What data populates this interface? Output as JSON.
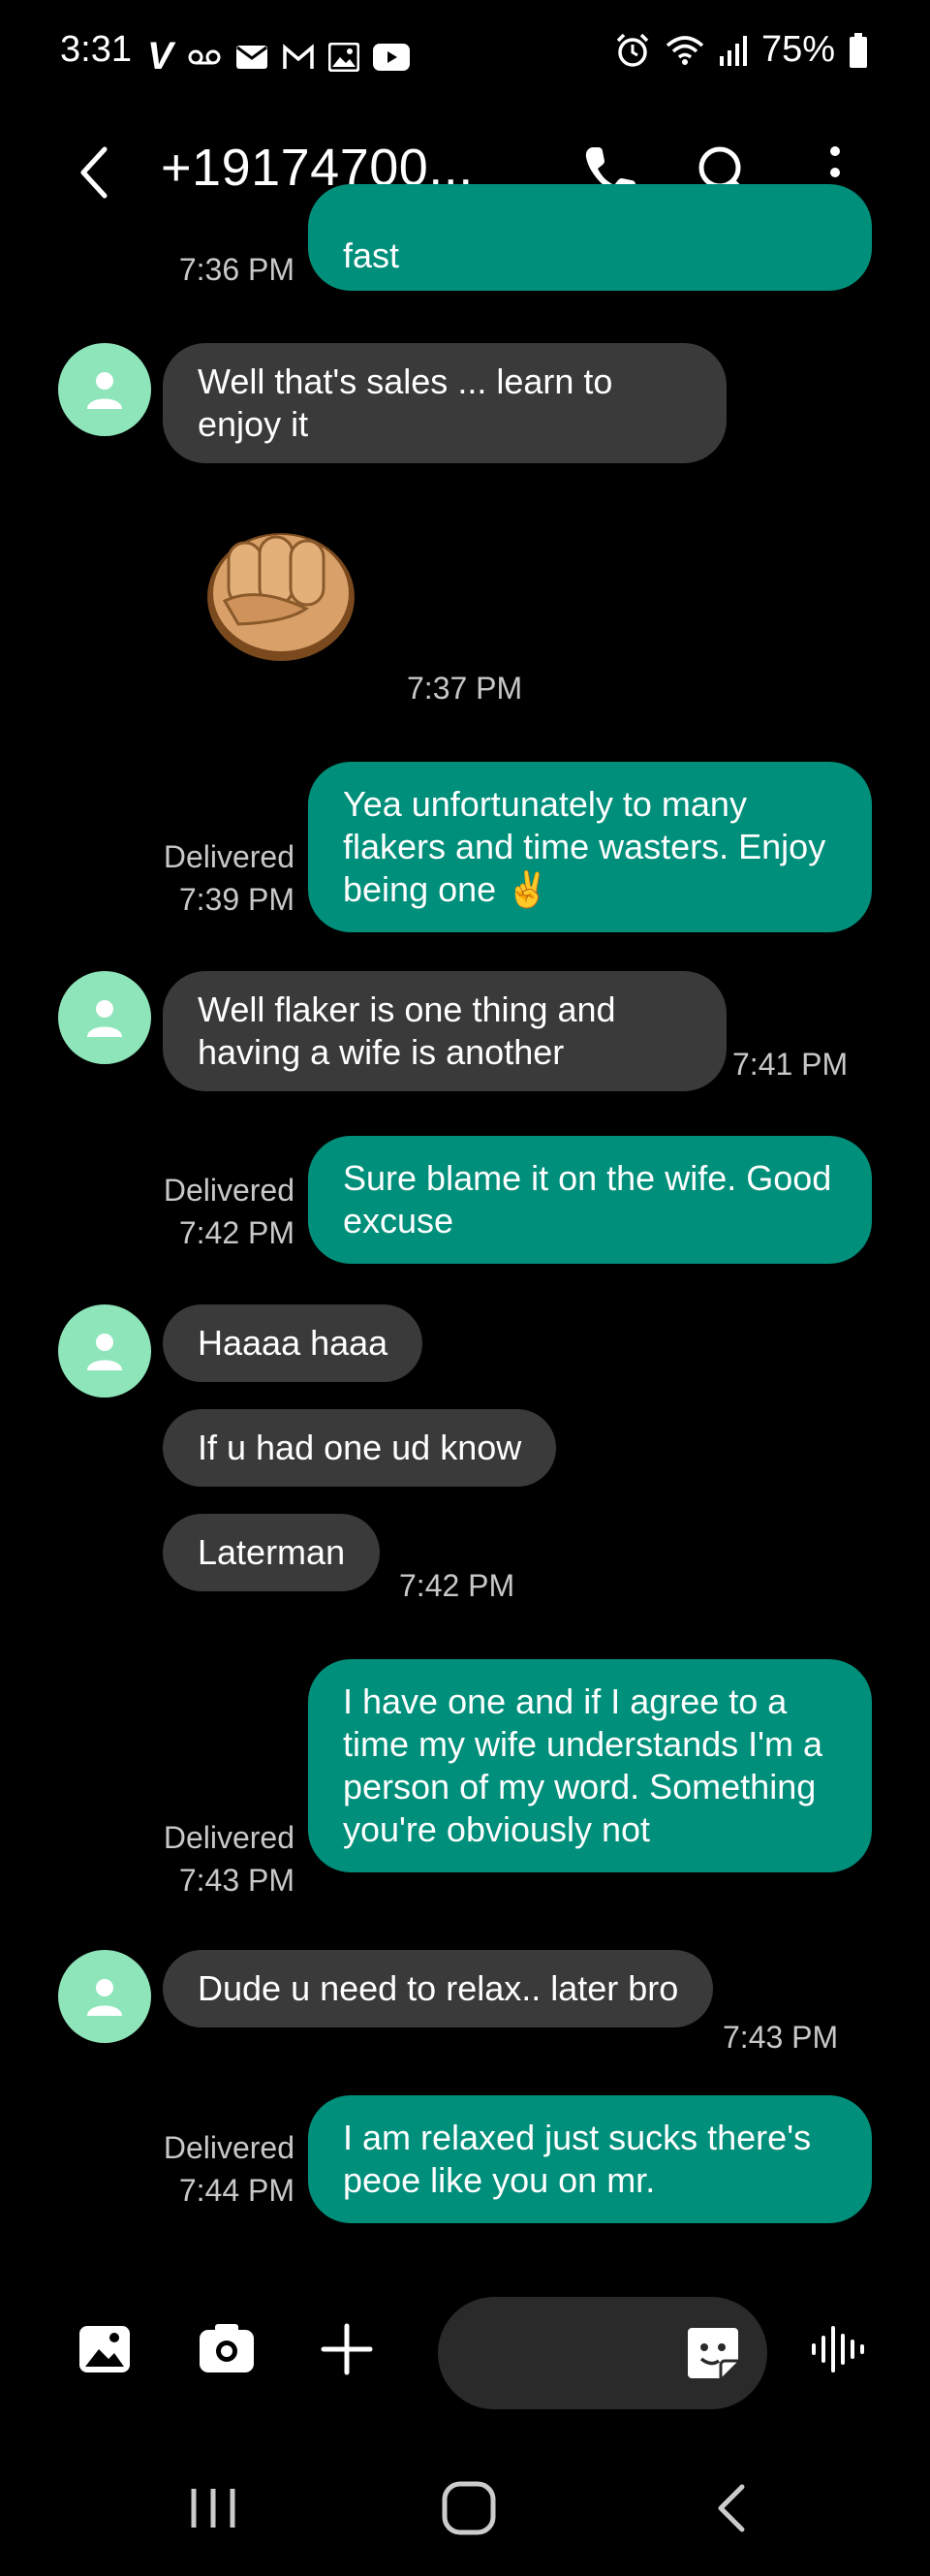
{
  "status": {
    "time": "3:31",
    "battery": "75%",
    "icons_left": [
      "verizon-icon",
      "voicemail-icon",
      "email-icon",
      "gmail-icon",
      "gallery-icon",
      "youtube-icon"
    ],
    "icons_right": [
      "alarm-icon",
      "wifi-icon",
      "signal-icon",
      "battery-icon"
    ]
  },
  "header": {
    "title": "+19174700...",
    "icons": [
      "back-icon",
      "phone-icon",
      "search-icon",
      "more-vert-icon"
    ]
  },
  "messages": [
    {
      "dir": "out",
      "text": "fast",
      "time": "7:36 PM",
      "status": ""
    },
    {
      "dir": "in",
      "text": "Well that's sales ... learn to enjoy it",
      "time": ""
    },
    {
      "dir": "in",
      "emoji": "fist-emoji",
      "time": "7:37 PM"
    },
    {
      "dir": "out",
      "text": "Yea unfortunately to many flakers and time wasters. Enjoy being one ✌️",
      "time": "7:39 PM",
      "status": "Delivered"
    },
    {
      "dir": "in",
      "text": "Well flaker is one thing and having a wife is another",
      "time": "7:41 PM"
    },
    {
      "dir": "out",
      "text": "Sure blame it on the wife. Good excuse",
      "time": "7:42 PM",
      "status": "Delivered"
    },
    {
      "dir": "in",
      "text": "Haaaa haaa",
      "time": ""
    },
    {
      "dir": "in",
      "text": "If u had one ud know",
      "time": ""
    },
    {
      "dir": "in",
      "text": "Laterman",
      "time": "7:42 PM"
    },
    {
      "dir": "out",
      "text": "I have one and if I agree to a time my wife understands I'm a person of my word. Something you're obviously not",
      "time": "7:43 PM",
      "status": "Delivered"
    },
    {
      "dir": "in",
      "text": "Dude u need to relax.. later bro",
      "time": "7:43 PM"
    },
    {
      "dir": "out",
      "text": "I am relaxed just sucks there's peoe like you on mr.",
      "time": "7:44 PM",
      "status": "Delivered"
    }
  ],
  "composer": {
    "icons": [
      "gallery-attach-icon",
      "camera-icon",
      "plus-icon",
      "sticker-icon",
      "voice-icon"
    ],
    "placeholder": ""
  },
  "nav": {
    "icons": [
      "recents-icon",
      "home-icon",
      "back-nav-icon"
    ]
  },
  "colors": {
    "incoming": "#3a3a3a",
    "outgoing": "#008f7a",
    "avatar": "#8ee5ba",
    "background": "#000000"
  }
}
